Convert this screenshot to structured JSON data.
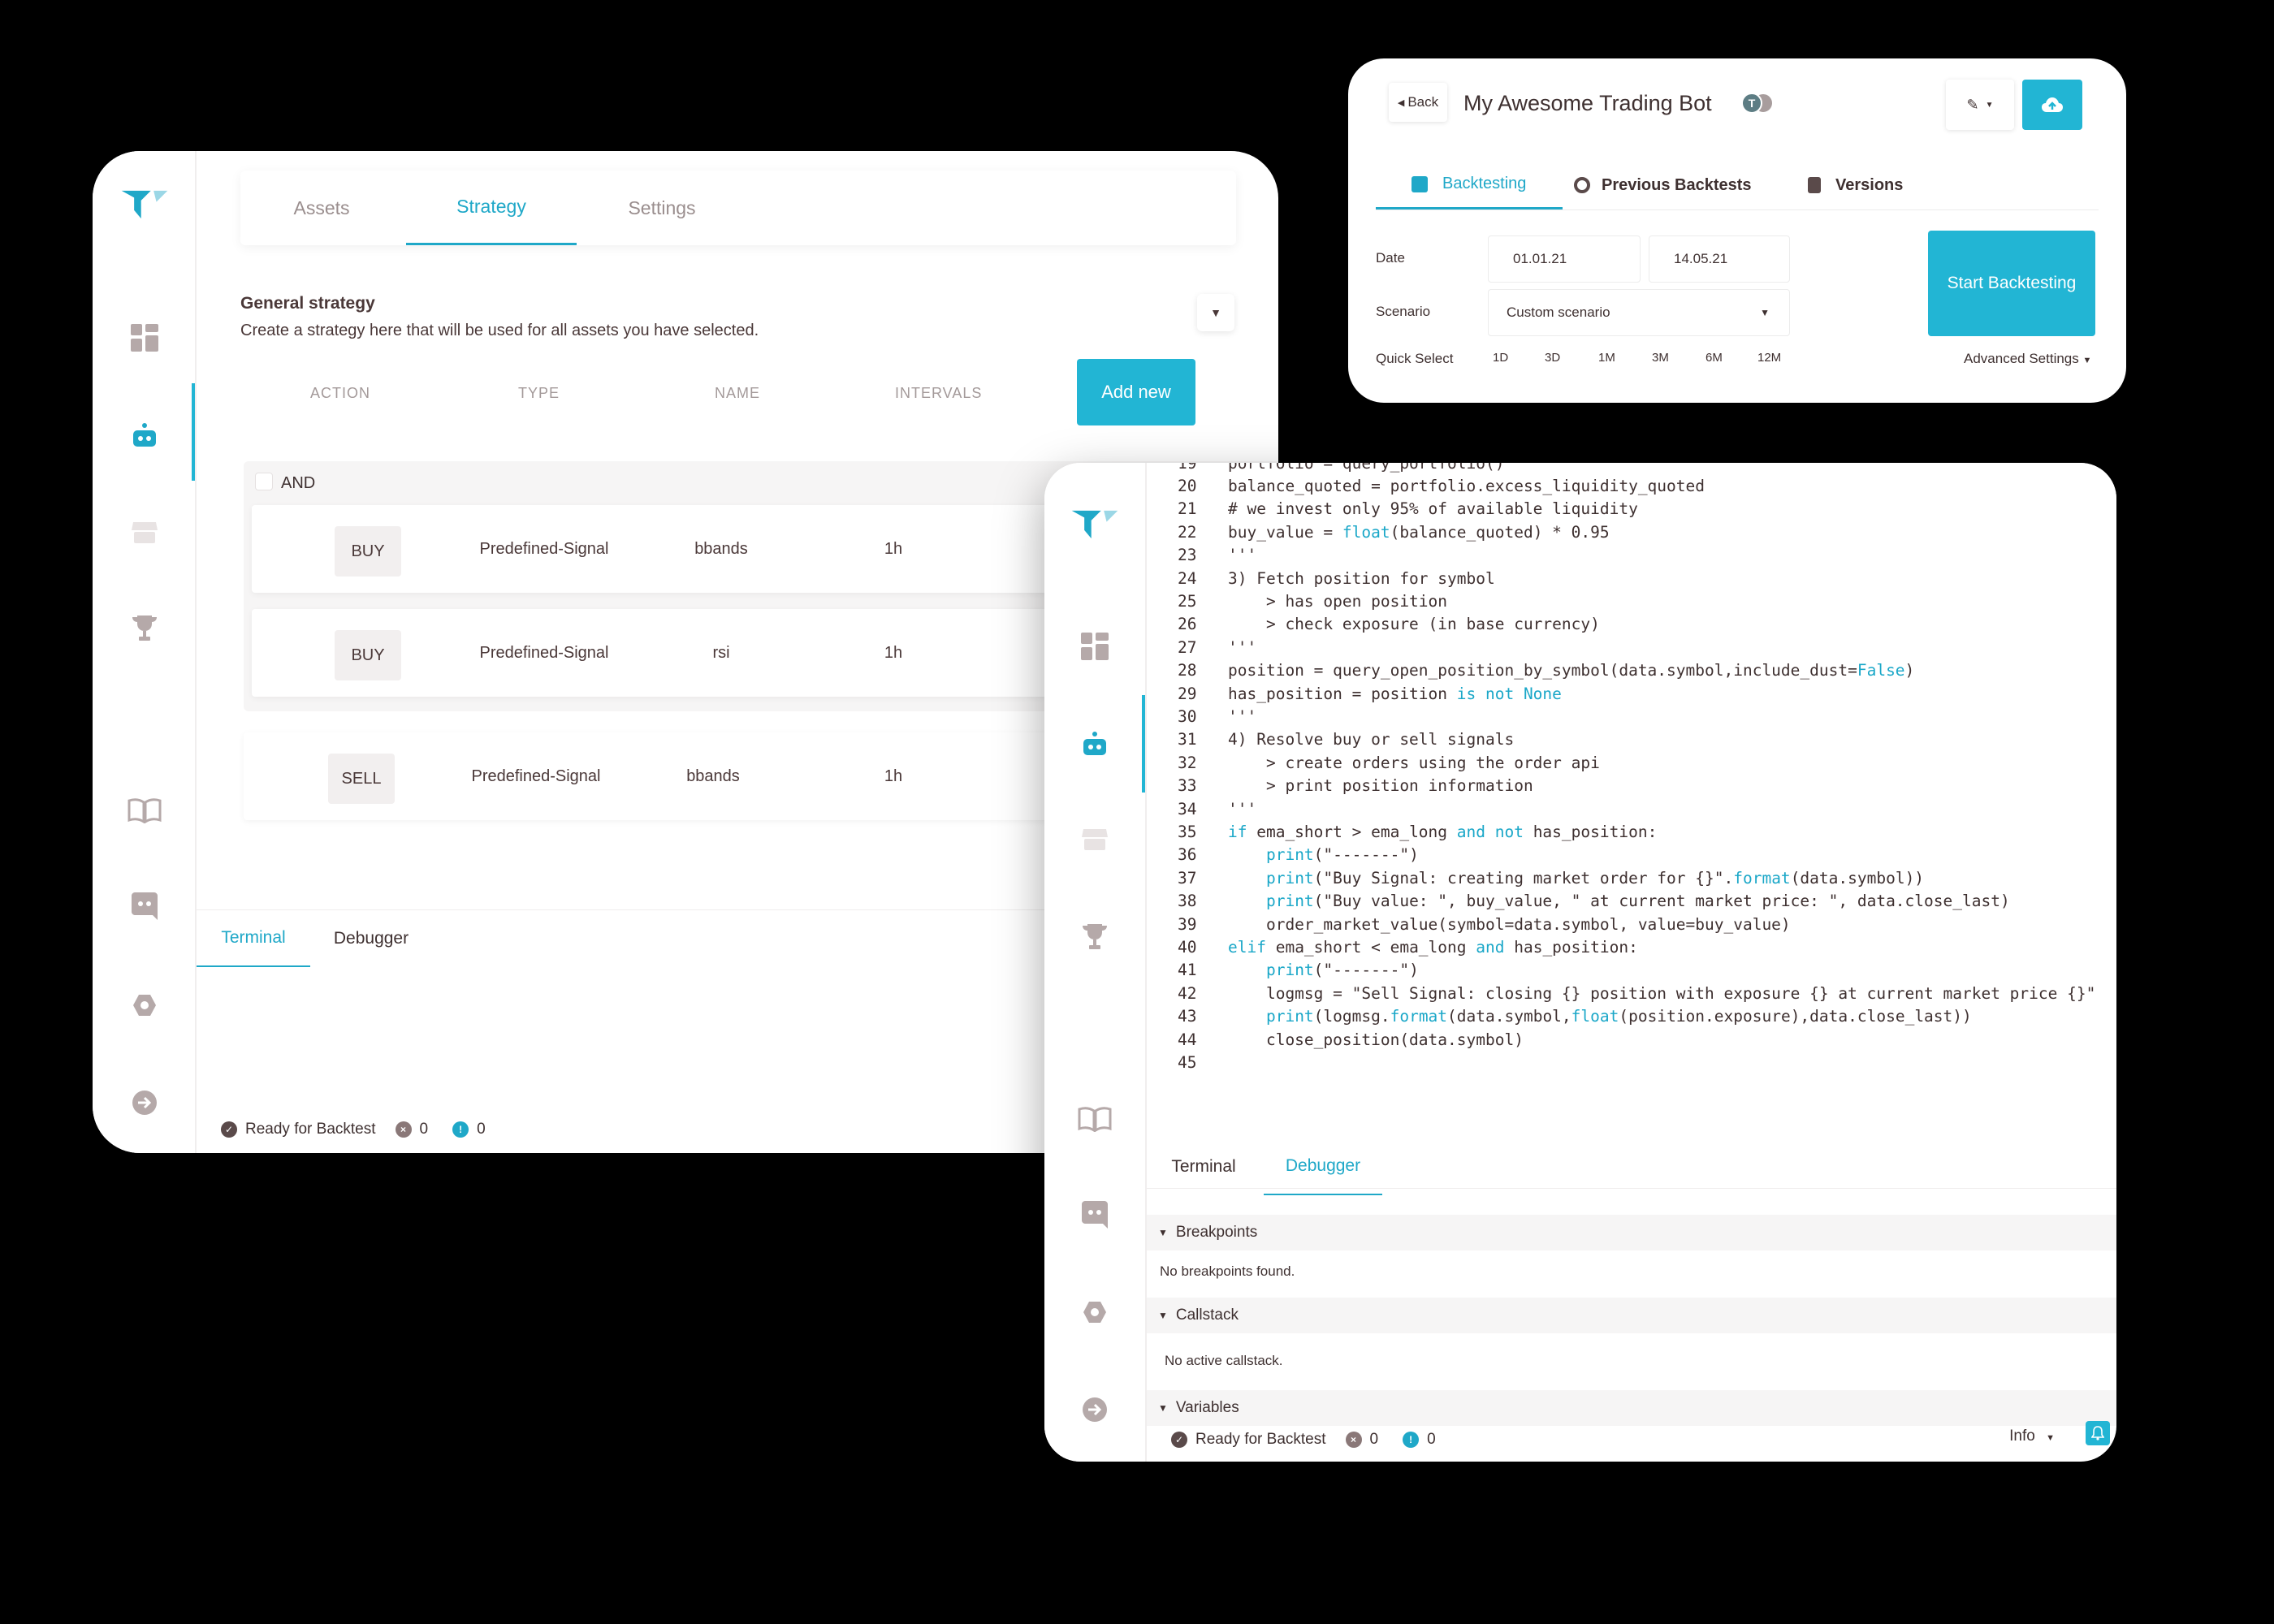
{
  "colors": {
    "accent": "#22b5d4",
    "text": "#3e3030",
    "muted": "#a39999",
    "icon": "#b5a9a9"
  },
  "strategy_window": {
    "tabs": [
      "Assets",
      "Strategy",
      "Settings"
    ],
    "active_tab": "Strategy",
    "section_title": "General strategy",
    "section_description": "Create a strategy here that will be used for all assets you have selected.",
    "columns": [
      "ACTION",
      "TYPE",
      "NAME",
      "INTERVALS"
    ],
    "add_new_label": "Add new",
    "group_label": "AND",
    "rules": [
      {
        "action": "BUY",
        "type": "Predefined-Signal",
        "name": "bbands",
        "interval": "1h"
      },
      {
        "action": "BUY",
        "type": "Predefined-Signal",
        "name": "rsi",
        "interval": "1h"
      },
      {
        "action": "SELL",
        "type": "Predefined-Signal",
        "name": "bbands",
        "interval": "1h"
      }
    ],
    "bottom_tabs": [
      "Terminal",
      "Debugger"
    ],
    "status": {
      "text": "Ready for Backtest",
      "errors": "0",
      "warnings": "0"
    }
  },
  "backtest_window": {
    "back_label": "Back",
    "bot_name": "My Awesome Trading Bot",
    "avatar_initial": "T",
    "tabs": [
      "Backtesting",
      "Previous Backtests",
      "Versions"
    ],
    "date_label": "Date",
    "date_from": "01.01.21",
    "date_to": "14.05.21",
    "scenario_label": "Scenario",
    "scenario_value": "Custom scenario",
    "quick_select_label": "Quick Select",
    "quick_select_options": [
      "1D",
      "3D",
      "1M",
      "3M",
      "6M",
      "12M"
    ],
    "start_label": "Start Backtesting",
    "advanced_label": "Advanced Settings"
  },
  "code_window": {
    "lines": [
      {
        "n": "19",
        "tokens": [
          [
            "portfolio = query_portfolio()",
            ""
          ]
        ]
      },
      {
        "n": "20",
        "tokens": [
          [
            "balance_quoted = portfolio.excess_liquidity_quoted",
            ""
          ]
        ]
      },
      {
        "n": "21",
        "tokens": [
          [
            "# we invest only 95% of available liquidity",
            ""
          ]
        ]
      },
      {
        "n": "22",
        "tokens": [
          [
            "buy_value = ",
            ""
          ],
          [
            "float",
            "kw"
          ],
          [
            "(balance_quoted) * 0.95",
            ""
          ]
        ]
      },
      {
        "n": "23",
        "tokens": [
          [
            "'''",
            ""
          ]
        ]
      },
      {
        "n": "24",
        "tokens": [
          [
            "3) Fetch position for symbol",
            ""
          ]
        ]
      },
      {
        "n": "25",
        "tokens": [
          [
            "    > has open position",
            ""
          ]
        ]
      },
      {
        "n": "26",
        "tokens": [
          [
            "    > check exposure (in base currency)",
            ""
          ]
        ]
      },
      {
        "n": "27",
        "tokens": [
          [
            "'''",
            ""
          ]
        ]
      },
      {
        "n": "28",
        "tokens": [
          [
            "position = query_open_position_by_symbol(data.symbol,include_dust=",
            ""
          ],
          [
            "False",
            "kw"
          ],
          [
            ")",
            ""
          ]
        ]
      },
      {
        "n": "29",
        "tokens": [
          [
            "has_position = position ",
            ""
          ],
          [
            "is not None",
            "kw"
          ]
        ]
      },
      {
        "n": "30",
        "tokens": [
          [
            "'''",
            ""
          ]
        ]
      },
      {
        "n": "31",
        "tokens": [
          [
            "4) Resolve buy or sell signals",
            ""
          ]
        ]
      },
      {
        "n": "32",
        "tokens": [
          [
            "    > create orders using the order api",
            ""
          ]
        ]
      },
      {
        "n": "33",
        "tokens": [
          [
            "    > print position information",
            ""
          ]
        ]
      },
      {
        "n": "34",
        "tokens": [
          [
            "'''",
            ""
          ]
        ]
      },
      {
        "n": "35",
        "tokens": [
          [
            "if",
            "kw"
          ],
          [
            " ema_short > ema_long ",
            ""
          ],
          [
            "and not",
            "kw"
          ],
          [
            " has_position:",
            ""
          ]
        ]
      },
      {
        "n": "36",
        "tokens": [
          [
            "    ",
            ""
          ],
          [
            "print",
            "kw"
          ],
          [
            "(\"-------\")",
            ""
          ]
        ]
      },
      {
        "n": "37",
        "tokens": [
          [
            "    ",
            ""
          ],
          [
            "print",
            "kw"
          ],
          [
            "(\"Buy Signal: creating market order for {}\".",
            ""
          ],
          [
            "format",
            "kw"
          ],
          [
            "(data.symbol))",
            ""
          ]
        ]
      },
      {
        "n": "38",
        "tokens": [
          [
            "    ",
            ""
          ],
          [
            "print",
            "kw"
          ],
          [
            "(\"Buy value: \", buy_value, \" at current market price: \", data.close_last)",
            ""
          ]
        ]
      },
      {
        "n": "39",
        "tokens": [
          [
            "    order_market_value(symbol=data.symbol, value=buy_value)",
            ""
          ]
        ]
      },
      {
        "n": "40",
        "tokens": [
          [
            "elif",
            "kw"
          ],
          [
            " ema_short < ema_long ",
            ""
          ],
          [
            "and",
            "kw"
          ],
          [
            " has_position:",
            ""
          ]
        ]
      },
      {
        "n": "41",
        "tokens": [
          [
            "    ",
            ""
          ],
          [
            "print",
            "kw"
          ],
          [
            "(\"-------\")",
            ""
          ]
        ]
      },
      {
        "n": "42",
        "tokens": [
          [
            "    logmsg = \"Sell Signal: closing {} position with exposure {} at current market price {}\"",
            ""
          ]
        ]
      },
      {
        "n": "43",
        "tokens": [
          [
            "    ",
            ""
          ],
          [
            "print",
            "kw"
          ],
          [
            "(logmsg.",
            ""
          ],
          [
            "format",
            "kw"
          ],
          [
            "(data.symbol,",
            ""
          ],
          [
            "float",
            "kw"
          ],
          [
            "(position.exposure),data.close_last))",
            ""
          ]
        ]
      },
      {
        "n": "44",
        "tokens": [
          [
            "    close_position(data.symbol)",
            ""
          ]
        ]
      },
      {
        "n": "45",
        "tokens": [
          [
            "",
            ""
          ]
        ]
      }
    ],
    "bottom_tabs": [
      "Terminal",
      "Debugger"
    ],
    "active_bottom_tab": "Debugger",
    "sections": {
      "breakpoints": "Breakpoints",
      "breakpoints_empty": "No breakpoints found.",
      "callstack": "Callstack",
      "callstack_empty": "No active callstack.",
      "variables": "Variables"
    },
    "status": {
      "text": "Ready for Backtest",
      "errors": "0",
      "warnings": "0"
    },
    "log_level": "Info"
  }
}
